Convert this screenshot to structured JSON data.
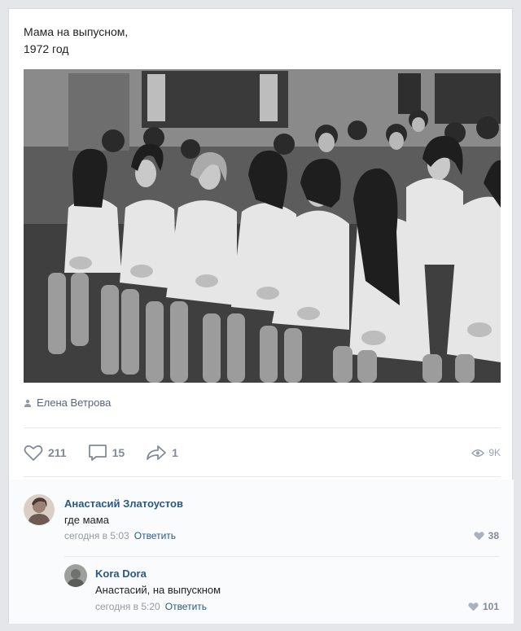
{
  "post": {
    "text": "Мама на выпусном,\n1972 год",
    "author": "Елена Ветрова"
  },
  "actions": {
    "likes": "211",
    "comments": "15",
    "shares": "1",
    "views": "9K"
  },
  "comments": [
    {
      "author": "Анастасий Златоустов",
      "text": "где мама",
      "time": "сегодня в 5:03",
      "reply_label": "Ответить",
      "likes": "38"
    },
    {
      "author": "Kora Dora",
      "text": "Анастасий, на выпускном",
      "time": "сегодня в 5:20",
      "reply_label": "Ответить",
      "likes": "101"
    }
  ],
  "icons": {
    "like": "heart-icon",
    "comment": "speech-bubble-icon",
    "share": "share-arrow-icon",
    "views": "eye-icon",
    "author": "person-icon"
  },
  "colors": {
    "link": "#2a5885",
    "muted": "#828a99",
    "background": "#e4e6e9"
  }
}
